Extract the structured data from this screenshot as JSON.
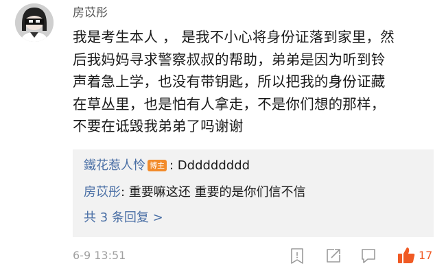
{
  "comment": {
    "username": "房苡彤",
    "lines": [
      "我是考生本人 ， 是我不小心将身份证落到家里，然",
      "后我妈妈寻求警察叔叔的帮助，弟弟是因为听到铃",
      "声着急上学，也没有带钥匙，所以把我的身份证藏",
      "在草丛里，也是怕有人拿走，不是你们想的那样，",
      "不要在诋毁我弟弟了吗谢谢"
    ],
    "avatar_icon": "avatar-photo"
  },
  "replies": [
    {
      "name": "鐵花惹人怜",
      "badge": "博主",
      "text": ": Ddddddddd"
    },
    {
      "name": "房苡彤",
      "badge": "",
      "text": ": 重要嘛这还 重要的是你们信不信"
    }
  ],
  "view_replies": "共 3 条回复 >",
  "footer": {
    "time": "6-9 13:51",
    "like_count": "17",
    "icons": [
      "delete-icon",
      "share-icon",
      "comment-icon",
      "like-icon"
    ],
    "like_color": "#f05a24"
  },
  "colors": {
    "link": "#4a6fa5",
    "badge": "#f28b2b",
    "reply_bg": "#f2f2f2"
  }
}
